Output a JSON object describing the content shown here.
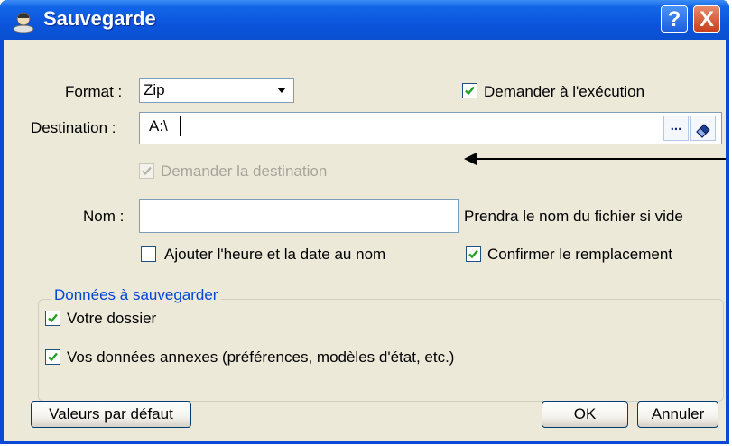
{
  "window": {
    "title": "Sauvegarde",
    "help_label": "?",
    "close_label": "X"
  },
  "form": {
    "format_label": "Format :",
    "format_value": "Zip",
    "ask_on_exec_label": "Demander à l'exécution",
    "ask_on_exec_checked": true,
    "destination_label": "Destination :",
    "destination_value": "A:\\",
    "browse_label": "...",
    "ask_destination_label": "Demander la destination",
    "ask_destination_checked": true,
    "name_label": "Nom :",
    "name_value": "",
    "name_hint": "Prendra le nom du fichier si vide",
    "add_datetime_label": "Ajouter l'heure et la date au nom",
    "add_datetime_checked": false,
    "confirm_replace_label": "Confirmer le remplacement",
    "confirm_replace_checked": true
  },
  "group": {
    "title": "Données à sauvegarder",
    "folder_label": "Votre dossier",
    "folder_checked": true,
    "annex_label": "Vos données annexes (préférences, modèles d'état, etc.)",
    "annex_checked": true
  },
  "buttons": {
    "defaults_label": "Valeurs par défaut",
    "ok_label": "OK",
    "cancel_label": "Annuler"
  },
  "colors": {
    "titlebar": "#0a4fd0",
    "face": "#ece9d8",
    "group_title": "#0046d5",
    "check": "#21a121"
  }
}
